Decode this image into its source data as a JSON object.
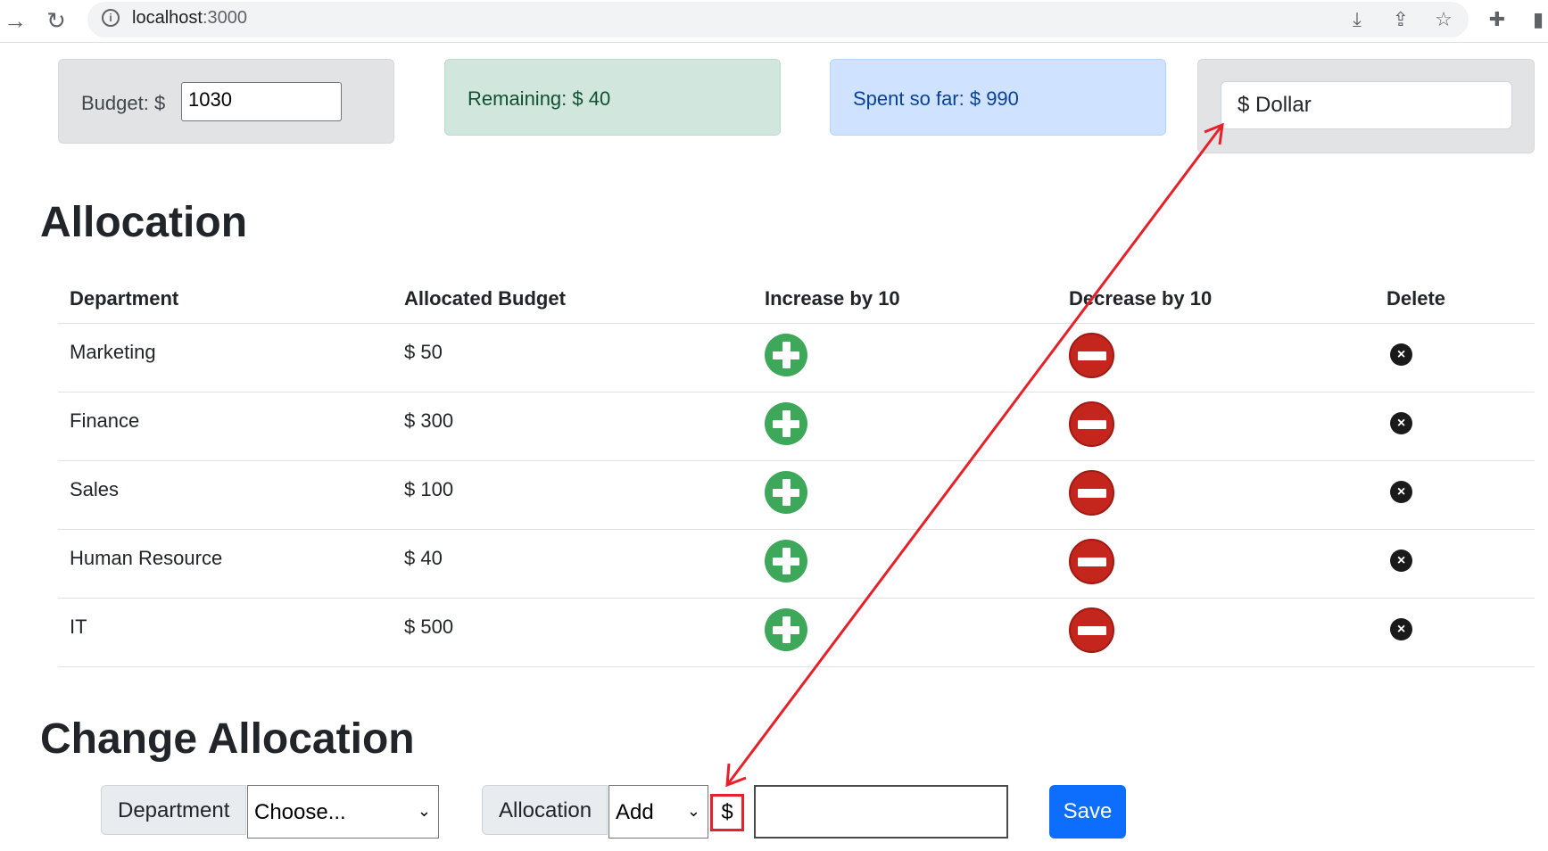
{
  "browser": {
    "url_host": "localhost",
    "url_port": ":3000"
  },
  "budget": {
    "label": "Budget: $",
    "value": "1030"
  },
  "remaining": {
    "text": "Remaining: $ 40"
  },
  "spent": {
    "text": "Spent so far: $ 990"
  },
  "currency": {
    "selected": "$ Dollar"
  },
  "allocation": {
    "heading": "Allocation",
    "columns": [
      "Department",
      "Allocated Budget",
      "Increase by 10",
      "Decrease by 10",
      "Delete"
    ],
    "rows": [
      {
        "department": "Marketing",
        "budget": "$ 50"
      },
      {
        "department": "Finance",
        "budget": "$ 300"
      },
      {
        "department": "Sales",
        "budget": "$ 100"
      },
      {
        "department": "Human Resource",
        "budget": "$ 40"
      },
      {
        "department": "IT",
        "budget": "$ 500"
      }
    ]
  },
  "change": {
    "heading": "Change Allocation",
    "department_label": "Department",
    "department_select": "Choose...",
    "allocation_label": "Allocation",
    "action_select": "Add",
    "currency_symbol": "$",
    "amount_value": "",
    "save_label": "Save"
  },
  "colors": {
    "annotation": "#e8202a",
    "increase": "#3da75a",
    "decrease": "#c4261d",
    "save": "#0d6efd"
  }
}
